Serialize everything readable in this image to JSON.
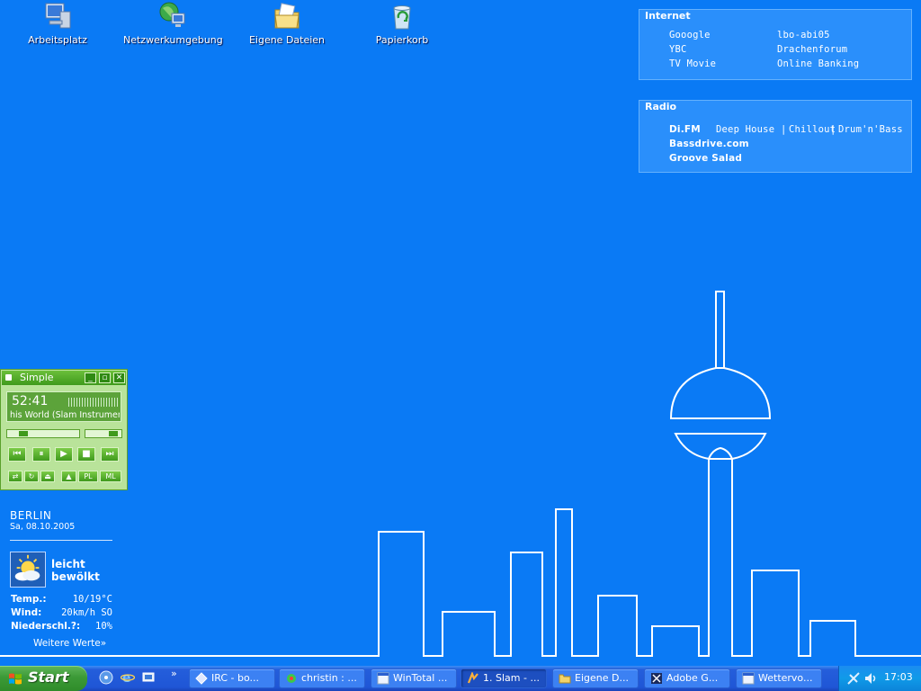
{
  "desktop": {
    "icons": [
      {
        "label": "Arbeitsplatz",
        "icon": "my-computer-icon"
      },
      {
        "label": "Netzwerkumgebung",
        "icon": "network-places-icon"
      },
      {
        "label": "Eigene Dateien",
        "icon": "my-documents-icon"
      },
      {
        "label": "Papierkorb",
        "icon": "recycle-bin-icon"
      }
    ]
  },
  "internet_panel": {
    "title": "Internet",
    "links": [
      "Gooogle",
      "lbo-abi05",
      "YBC",
      "Drachenforum",
      "TV Movie",
      "Online Banking"
    ]
  },
  "radio_panel": {
    "title": "Radio",
    "station1": "Di.FM",
    "station1_genres": [
      "Deep House",
      "Chillout",
      "Drum'n'Bass"
    ],
    "separator": "|",
    "station2": "Bassdrive.com",
    "station3": "Groove Salad"
  },
  "winamp": {
    "title": "Simple",
    "time": "52:41",
    "track": "his World (Slam Instrumen",
    "seek_fraction": 0.18,
    "volume_fraction": 0.9,
    "small_buttons": [
      "PL",
      "ML"
    ]
  },
  "weather": {
    "city": "BERLIN",
    "date": "Sa, 08.10.2005",
    "condition_line1": "leicht",
    "condition_line2": "bewölkt",
    "temp_label": "Temp.:",
    "temp_value": "10/19°C",
    "wind_label": "Wind:",
    "wind_value": "20km/h SO",
    "rain_label": "Niederschl.?:",
    "rain_value": "10%",
    "more_link": "Weitere Werte»"
  },
  "taskbar": {
    "start_label": "Start",
    "quicklaunch_more": "»",
    "tasks": [
      {
        "label": "IRC - bo...",
        "icon": "irc-icon",
        "active": false
      },
      {
        "label": "christin : ...",
        "icon": "icq-icon",
        "active": false
      },
      {
        "label": "WinTotal ...",
        "icon": "browser-icon",
        "active": false
      },
      {
        "label": "1. Slam - ...",
        "icon": "winamp-icon",
        "active": true
      },
      {
        "label": "Eigene D...",
        "icon": "folder-icon",
        "active": false
      },
      {
        "label": "Adobe G...",
        "icon": "adobe-icon",
        "active": false
      },
      {
        "label": "Wettervo...",
        "icon": "browser-icon",
        "active": false
      }
    ],
    "clock": "17:03"
  }
}
